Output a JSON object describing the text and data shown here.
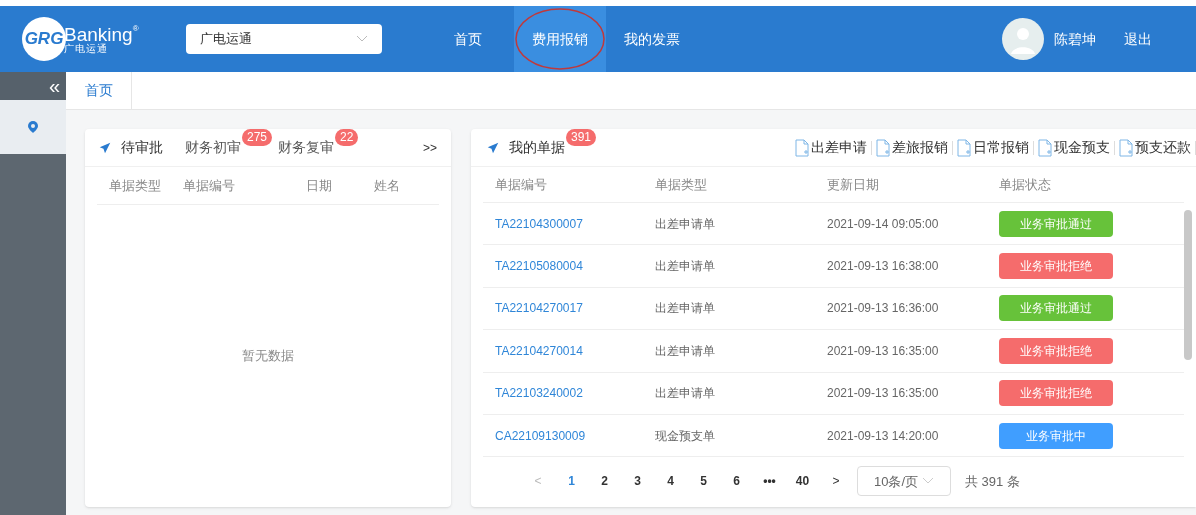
{
  "header": {
    "logo": {
      "mark": "GRG",
      "word": "Banking",
      "sub": "广电运通",
      "reg": "®"
    },
    "company_select": {
      "value": "广电运通"
    },
    "nav": [
      {
        "label": "首页",
        "selected": false,
        "annotated": false
      },
      {
        "label": "费用报销",
        "selected": true,
        "annotated": true
      },
      {
        "label": "我的发票",
        "selected": false,
        "annotated": false
      }
    ],
    "user": {
      "name": "陈碧坤"
    },
    "logout": "退出"
  },
  "sidebar": {
    "collapse": "«"
  },
  "page_tabs": [
    {
      "label": "首页",
      "selected": true
    }
  ],
  "pending_card": {
    "title": "待审批",
    "tabs": [
      {
        "label": "财务初审",
        "badge": "275"
      },
      {
        "label": "财务复审",
        "badge": "22"
      }
    ],
    "more": ">>",
    "columns": [
      "单据类型",
      "单据编号",
      "日期",
      "姓名"
    ],
    "empty": "暂无数据"
  },
  "my_docs_card": {
    "title": "我的单据",
    "badge": "391",
    "actions": [
      "出差申请",
      "差旅报销",
      "日常报销",
      "现金预支",
      "预支还款"
    ],
    "columns": [
      "单据编号",
      "单据类型",
      "更新日期",
      "单据状态"
    ],
    "rows": [
      {
        "number": "TA22104300007",
        "type": "出差申请单",
        "date": "2021-09-14 09:05:00",
        "status": "业务审批通过",
        "color": "#67c23a"
      },
      {
        "number": "TA22105080004",
        "type": "出差申请单",
        "date": "2021-09-13 16:38:00",
        "status": "业务审批拒绝",
        "color": "#f56c6c"
      },
      {
        "number": "TA22104270017",
        "type": "出差申请单",
        "date": "2021-09-13 16:36:00",
        "status": "业务审批通过",
        "color": "#67c23a"
      },
      {
        "number": "TA22104270014",
        "type": "出差申请单",
        "date": "2021-09-13 16:35:00",
        "status": "业务审批拒绝",
        "color": "#f56c6c"
      },
      {
        "number": "TA22103240002",
        "type": "出差申请单",
        "date": "2021-09-13 16:35:00",
        "status": "业务审批拒绝",
        "color": "#f56c6c"
      },
      {
        "number": "CA22109130009",
        "type": "现金预支单",
        "date": "2021-09-13 14:20:00",
        "status": "业务审批中",
        "color": "#409eff"
      }
    ],
    "pagination": {
      "prev": "<",
      "pages": [
        {
          "label": "1",
          "selected": true
        },
        {
          "label": "2",
          "selected": false
        },
        {
          "label": "3",
          "selected": false
        },
        {
          "label": "4",
          "selected": false
        },
        {
          "label": "5",
          "selected": false
        },
        {
          "label": "6",
          "selected": false
        },
        {
          "label": "•••",
          "selected": false
        },
        {
          "label": "40",
          "selected": false
        }
      ],
      "next": ">",
      "page_size": "10条/页",
      "total": "共 391 条"
    }
  }
}
